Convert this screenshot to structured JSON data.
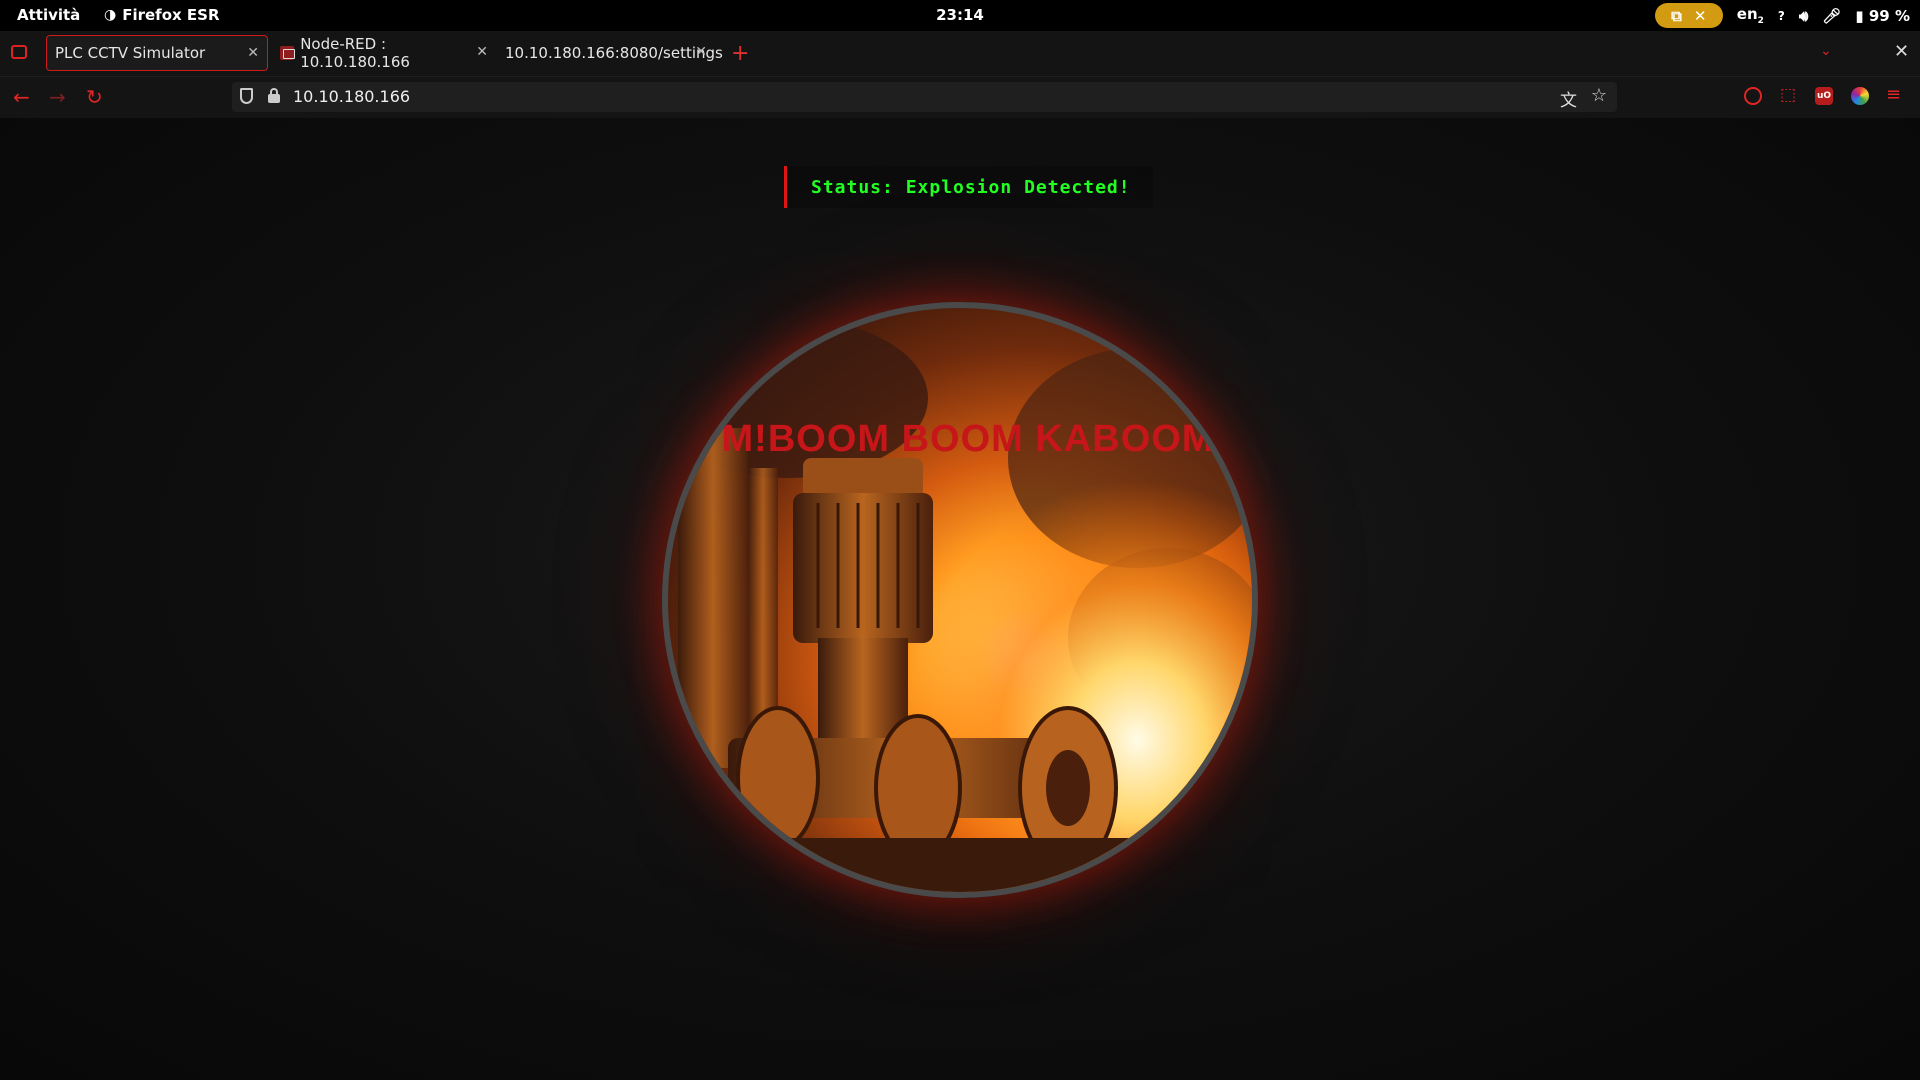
{
  "system_bar": {
    "activities": "Attività",
    "app_name": "Firefox ESR",
    "clock": "23:14",
    "language": "en",
    "language_sub": "2",
    "battery": "99 %"
  },
  "browser": {
    "tabs": [
      {
        "title": "PLC CCTV Simulator",
        "active": true
      },
      {
        "title": "Node-RED : 10.10.180.166",
        "active": false
      },
      {
        "title": "10.10.180.166:8080/settings",
        "active": false
      }
    ],
    "url": "10.10.180.166"
  },
  "page": {
    "status_text": "Status: Explosion Detected!",
    "camera_overlay_text": "M!BOOM BOOM KABOOM"
  },
  "colors": {
    "accent": "#e02525",
    "status_green": "#22ff22",
    "overlay_red": "#c6161a",
    "share_pill": "#d29b12"
  }
}
